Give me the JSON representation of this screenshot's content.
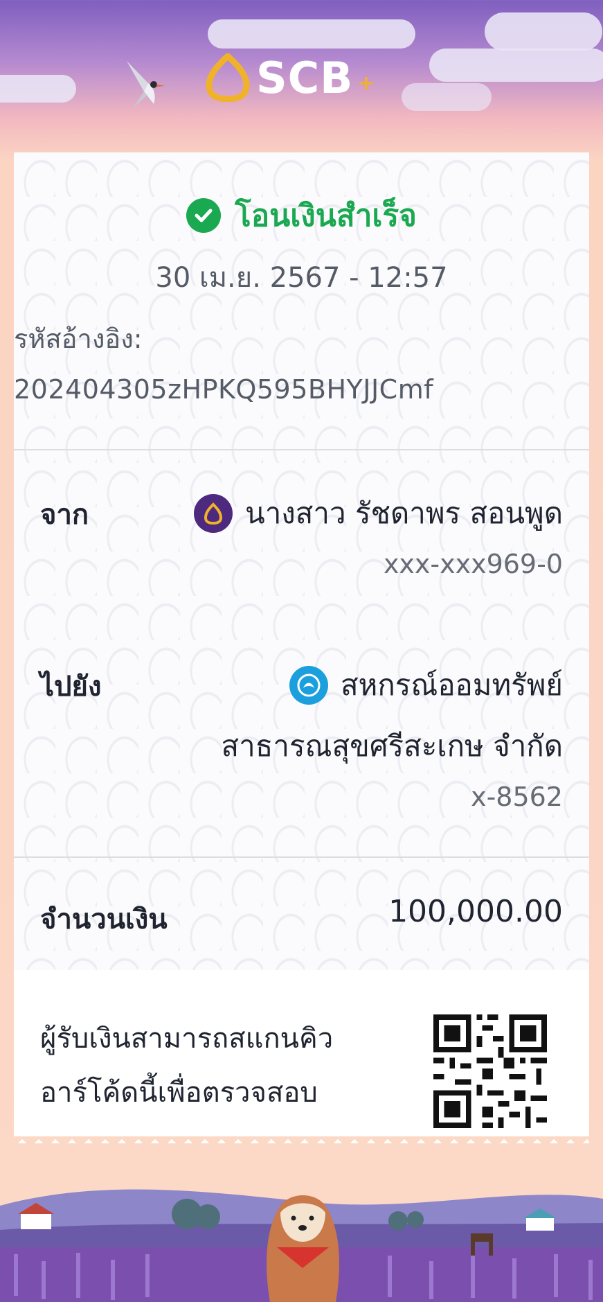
{
  "header": {
    "brand": "SCB",
    "brand_plus": "+",
    "colors": {
      "purple": "#7f5fbf",
      "gold": "#f1b22b"
    }
  },
  "receipt": {
    "status": "โอนเงินสำเร็จ",
    "datetime": "30 เม.ย. 2567 - 12:57",
    "ref_label": "รหัสอ้างอิง:",
    "ref_code": "202404305zHPKQ595BHYJJCmf",
    "from": {
      "label": "จาก",
      "name": "นางสาว รัชดาพร สอนพูด",
      "account": "xxx-xxx969-0",
      "bank_icon": "scb-icon"
    },
    "to": {
      "label": "ไปยัง",
      "name_line1": "สหกรณ์ออมทรัพย์",
      "name_line2": "สาธารณสุขศรีสะเกษ จำกัด",
      "account": "x-8562",
      "bank_icon": "kasikorn-icon"
    },
    "amount": {
      "label": "จำนวนเงิน",
      "value": "100,000.00"
    },
    "qr_note_line1": "ผู้รับเงินสามารถสแกนคิว",
    "qr_note_line2": "อาร์โค้ดนี้เพื่อตรวจสอบ"
  }
}
